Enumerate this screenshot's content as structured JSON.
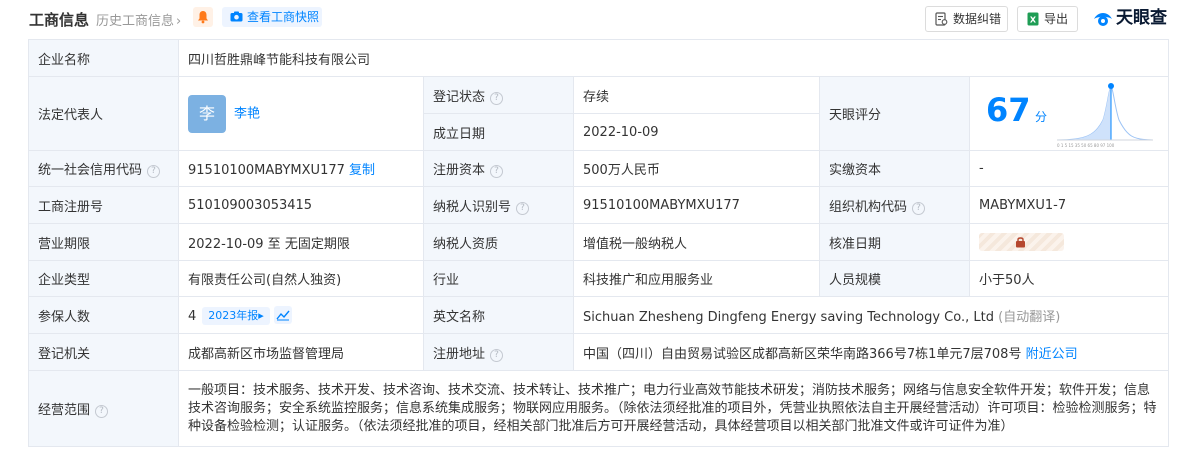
{
  "header": {
    "title": "工商信息",
    "history_label": "历史工商信息",
    "history_chevron": "›",
    "snapshot_label": "查看工商快照",
    "correct_label": "数据纠错",
    "export_label": "导出",
    "logo_text": "天眼查"
  },
  "colors": {
    "accent": "#0084ff",
    "status_green": "#00a650",
    "label_bg": "#f3f7fc",
    "border": "#e4e8ef"
  },
  "fields": {
    "company_name": {
      "label": "企业名称",
      "value": "四川哲胜鼎峰节能科技有限公司"
    },
    "legal_rep": {
      "label": "法定代表人",
      "avatar": "李",
      "name": "李艳"
    },
    "reg_status": {
      "label": "登记状态",
      "value": "存续"
    },
    "est_date": {
      "label": "成立日期",
      "value": "2022-10-09"
    },
    "tianyan_score": {
      "label": "天眼评分",
      "value": "67",
      "unit": "分"
    },
    "credit_code": {
      "label": "统一社会信用代码",
      "value": "91510100MABYMXU177",
      "copy": "复制"
    },
    "reg_capital": {
      "label": "注册资本",
      "value": "500万人民币"
    },
    "paid_capital": {
      "label": "实缴资本",
      "value": "-"
    },
    "reg_number": {
      "label": "工商注册号",
      "value": "510109003053415"
    },
    "taxpayer_id": {
      "label": "纳税人识别号",
      "value": "91510100MABYMXU177"
    },
    "org_code": {
      "label": "组织机构代码",
      "value": "MABYMXU1-7"
    },
    "term": {
      "label": "营业期限",
      "value": "2022-10-09 至 无固定期限"
    },
    "taxpayer_type": {
      "label": "纳税人资质",
      "value": "增值税一般纳税人"
    },
    "approval_date": {
      "label": "核准日期"
    },
    "company_type": {
      "label": "企业类型",
      "value": "有限责任公司(自然人独资)"
    },
    "industry": {
      "label": "行业",
      "value": "科技推广和应用服务业"
    },
    "staff_size": {
      "label": "人员规模",
      "value": "小于50人"
    },
    "insured": {
      "label": "参保人数",
      "value": "4",
      "report": "2023年报▸"
    },
    "english_name": {
      "label": "英文名称",
      "value": "Sichuan Zhesheng Dingfeng Energy saving Technology Co., Ltd",
      "note": "(自动翻译)"
    },
    "reg_authority": {
      "label": "登记机关",
      "value": "成都高新区市场监督管理局"
    },
    "reg_address": {
      "label": "注册地址",
      "value": "中国（四川）自由贸易试验区成都高新区荣华南路366号7栋1单元7层708号",
      "nearby": "附近公司"
    },
    "scope": {
      "label": "经营范围",
      "value": "一般项目：技术服务、技术开发、技术咨询、技术交流、技术转让、技术推广；电力行业高效节能技术研发；消防技术服务；网络与信息安全软件开发；软件开发；信息技术咨询服务；安全系统监控服务；信息系统集成服务；物联网应用服务。（除依法须经批准的项目外，凭营业执照依法自主开展经营活动）许可项目：检验检测服务；特种设备检验检测；认证服务。（依法须经批准的项目，经相关部门批准后方可开展经营活动，具体经营项目以相关部门批准文件或许可证件为准）"
    }
  }
}
